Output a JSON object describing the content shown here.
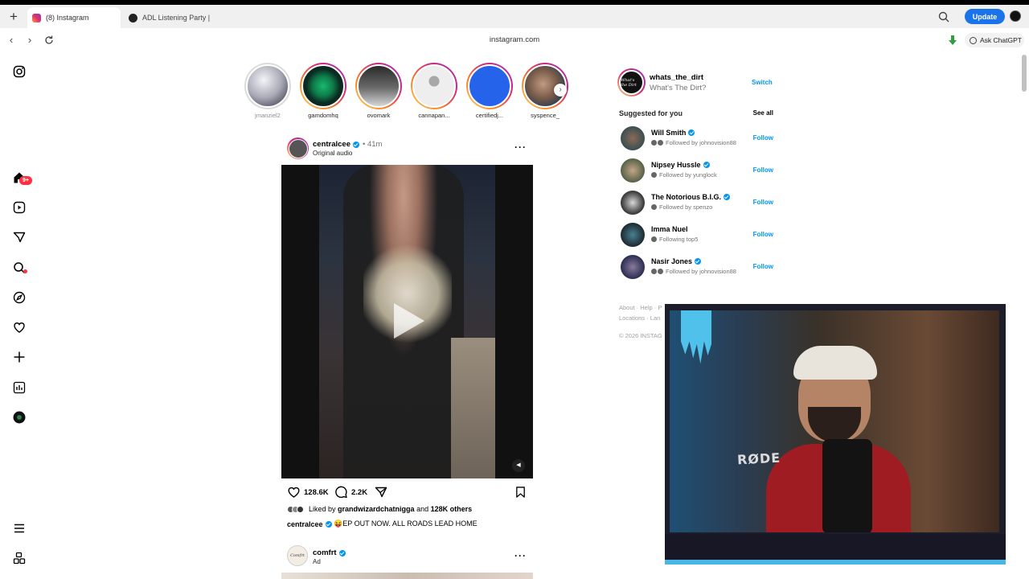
{
  "browser": {
    "tabs": [
      {
        "label": "(8) Instagram",
        "active": true
      },
      {
        "label": "ADL Listening Party |",
        "active": false
      }
    ],
    "update_label": "Update",
    "url": "instagram.com",
    "ask_chatgpt_label": "Ask ChatGPT"
  },
  "sidebar": {
    "notifications_badge": "9+",
    "icons": [
      "instagram-icon",
      "home-icon",
      "reels-icon",
      "messages-icon",
      "search-icon",
      "explore-icon",
      "notifications-icon",
      "create-icon",
      "dashboard-icon",
      "profile-avatar",
      "more-menu-icon",
      "also-from-meta-icon"
    ]
  },
  "stories": [
    {
      "name": "jmanziel2",
      "seen": true
    },
    {
      "name": "gamdomhq",
      "seen": false
    },
    {
      "name": "ovomark",
      "seen": false
    },
    {
      "name": "cannapan...",
      "seen": false
    },
    {
      "name": "certifiedj...",
      "seen": false
    },
    {
      "name": "syspence_",
      "seen": false
    }
  ],
  "post": {
    "username": "centralcee",
    "time": "• 41m",
    "audio": "Original audio",
    "likes": "128.6K",
    "comments": "2.2K",
    "liked_by_prefix": "Liked by",
    "liked_by_user": "grandwizardchatnigga",
    "liked_by_and": "and",
    "liked_by_others": "128K others",
    "caption_user": "centralcee",
    "caption_text": "😝EP OUT NOW. ALL ROADS LEAD HOME"
  },
  "post2": {
    "username": "comfrt",
    "label": "Ad",
    "avatar_text": "Comfrt"
  },
  "account": {
    "username": "whats_the_dirt",
    "full_name": "What's The Dirt?",
    "switch_label": "Switch",
    "avatar_text": "What's the Dirt"
  },
  "suggestions": {
    "title": "Suggested for you",
    "see_all": "See all",
    "follow_label": "Follow",
    "items": [
      {
        "name": "Will Smith",
        "verified": true,
        "sub": "Followed by johnovision88"
      },
      {
        "name": "Nipsey Hussle",
        "verified": true,
        "sub": "Followed by yunglock"
      },
      {
        "name": "The Notorious B.I.G.",
        "verified": true,
        "sub": "Followed by spenzo"
      },
      {
        "name": "Imma Nuel",
        "verified": false,
        "sub": "Following top5"
      },
      {
        "name": "Nasir Jones",
        "verified": true,
        "sub": "Followed by johnovision88"
      }
    ]
  },
  "footer": {
    "links_line1": "About · Help · P",
    "links_line2": "Locations · Lan",
    "copyright": "© 2026 INSTAG"
  },
  "overlay": {
    "mic_brand": "RØDE"
  },
  "colors": {
    "accent": "#0095f6",
    "badge": "#ff3040",
    "update_button": "#1a73e8"
  }
}
